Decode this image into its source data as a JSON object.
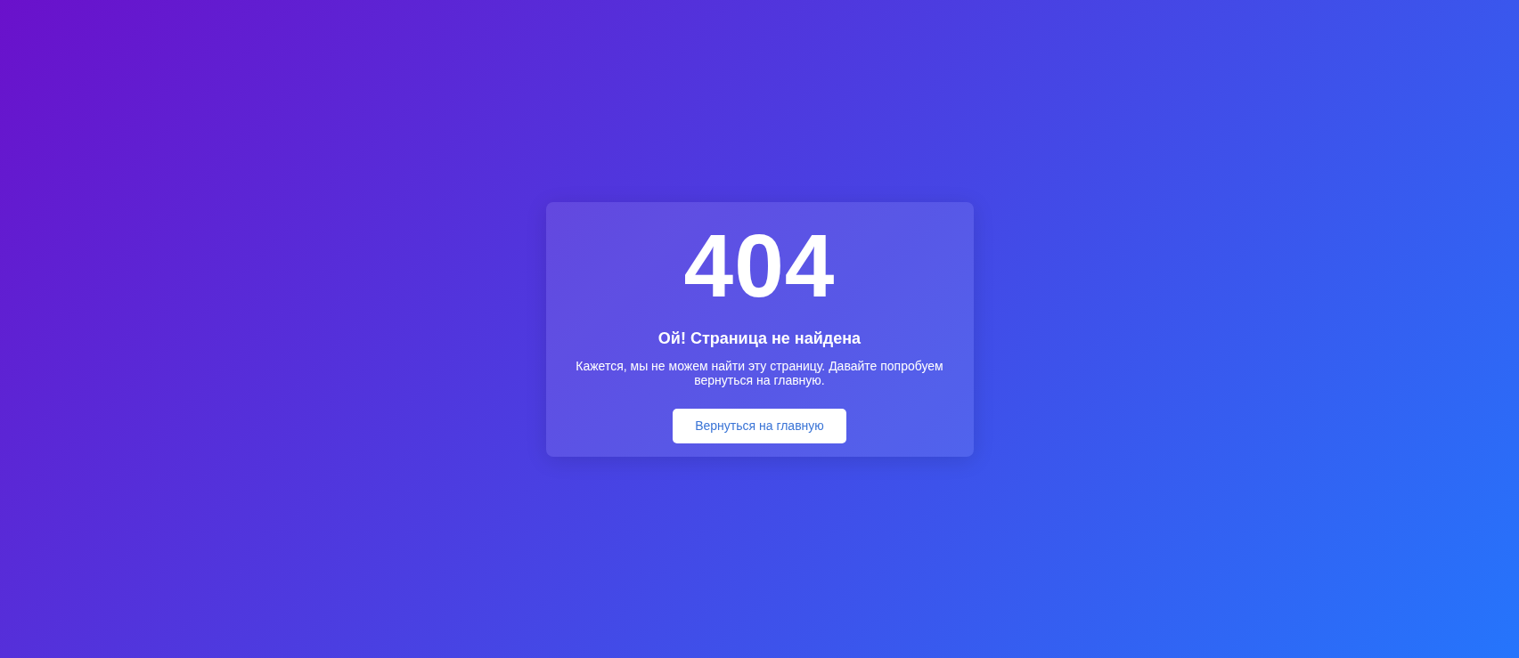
{
  "page": {
    "code": "404",
    "title": "Ой! Страница не найдена",
    "message": "Кажется, мы не можем найти эту страницу. Давайте попробуем вернуться на главную.",
    "button": "Вернуться на главную"
  }
}
